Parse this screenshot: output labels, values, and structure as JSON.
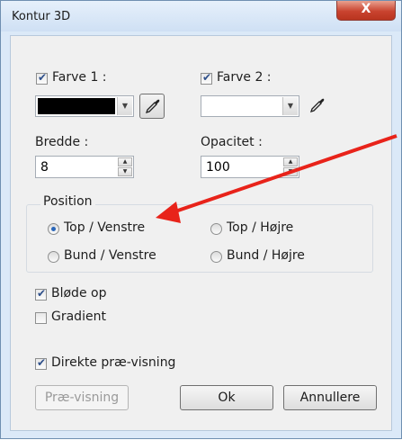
{
  "window": {
    "title": "Kontur 3D",
    "close_glyph": "X"
  },
  "color1": {
    "label": "Farve 1 :",
    "checked": true,
    "swatch": "#000000"
  },
  "color2": {
    "label": "Farve 2 :",
    "checked": true,
    "swatch": "#ffffff"
  },
  "width": {
    "label": "Bredde :",
    "value": "8"
  },
  "opacity": {
    "label": "Opacitet :",
    "value": "100"
  },
  "position": {
    "label": "Position",
    "options": [
      "Top / Venstre",
      "Top / Højre",
      "Bund / Venstre",
      "Bund / Højre"
    ],
    "selected": "Top / Venstre"
  },
  "options": {
    "blur": "Bløde op",
    "gradient": "Gradient",
    "preview_live": "Direkte præ-visning"
  },
  "buttons": {
    "preview": "Præ-visning",
    "ok": "Ok",
    "cancel": "Annullere"
  },
  "annotation": {
    "arrow_color": "#e8231a"
  }
}
